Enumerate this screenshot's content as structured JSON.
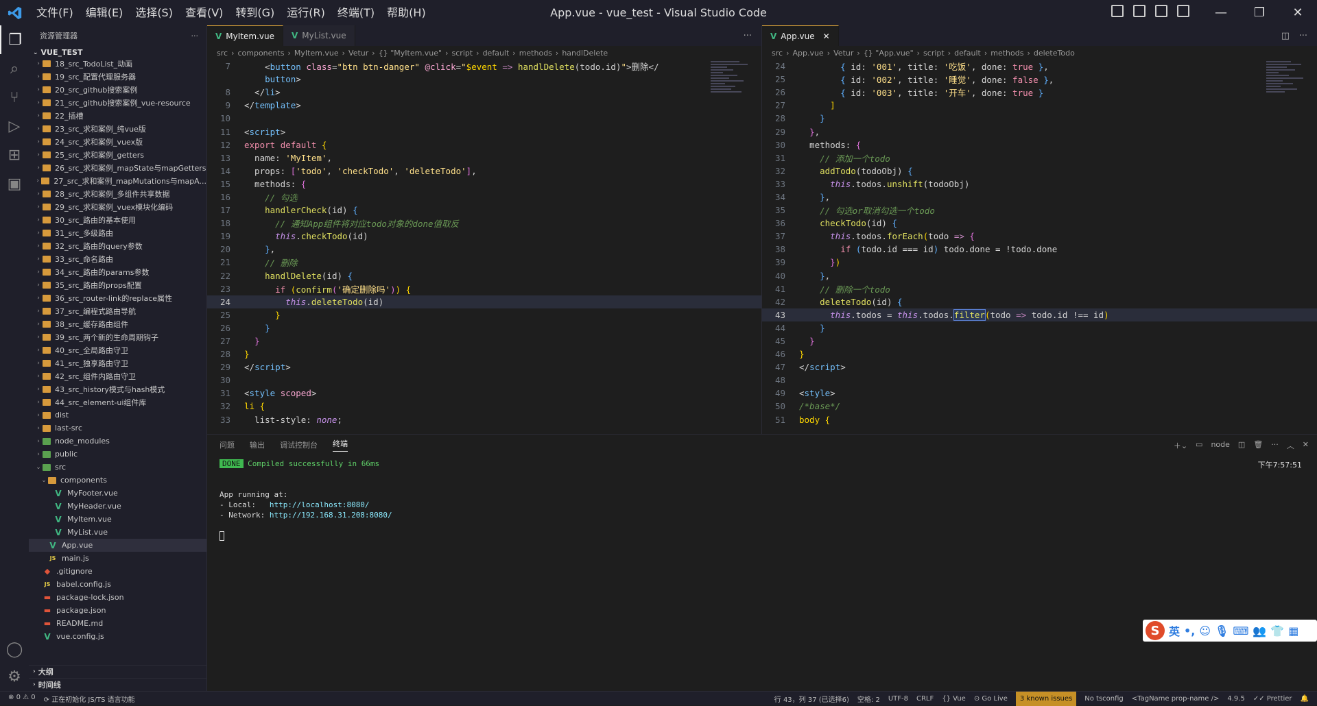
{
  "window": {
    "title": "App.vue - vue_test - Visual Studio Code"
  },
  "menu": [
    "文件(F)",
    "编辑(E)",
    "选择(S)",
    "查看(V)",
    "转到(G)",
    "运行(R)",
    "终端(T)",
    "帮助(H)"
  ],
  "sidebar": {
    "header": "资源管理器",
    "project": "VUE_TEST",
    "items": [
      {
        "label": "18_src_TodoList_动画",
        "icon": "folder",
        "indent": 1
      },
      {
        "label": "19_src_配置代理服务器",
        "icon": "folder",
        "indent": 1
      },
      {
        "label": "20_src_github搜索案例",
        "icon": "folder",
        "indent": 1
      },
      {
        "label": "21_src_github搜索案例_vue-resource",
        "icon": "folder",
        "indent": 1
      },
      {
        "label": "22_插槽",
        "icon": "folder",
        "indent": 1
      },
      {
        "label": "23_src_求和案例_纯vue版",
        "icon": "folder",
        "indent": 1
      },
      {
        "label": "24_src_求和案例_vuex版",
        "icon": "folder",
        "indent": 1
      },
      {
        "label": "25_src_求和案例_getters",
        "icon": "folder",
        "indent": 1
      },
      {
        "label": "26_src_求和案例_mapState与mapGetters",
        "icon": "folder",
        "indent": 1
      },
      {
        "label": "27_src_求和案例_mapMutations与mapA...",
        "icon": "folder",
        "indent": 1
      },
      {
        "label": "28_src_求和案例_多组件共享数据",
        "icon": "folder",
        "indent": 1
      },
      {
        "label": "29_src_求和案例_vuex模块化编码",
        "icon": "folder",
        "indent": 1
      },
      {
        "label": "30_src_路由的基本使用",
        "icon": "folder",
        "indent": 1
      },
      {
        "label": "31_src_多级路由",
        "icon": "folder",
        "indent": 1
      },
      {
        "label": "32_src_路由的query参数",
        "icon": "folder",
        "indent": 1
      },
      {
        "label": "33_src_命名路由",
        "icon": "folder",
        "indent": 1
      },
      {
        "label": "34_src_路由的params参数",
        "icon": "folder",
        "indent": 1
      },
      {
        "label": "35_src_路由的props配置",
        "icon": "folder",
        "indent": 1
      },
      {
        "label": "36_src_router-link的replace属性",
        "icon": "folder",
        "indent": 1
      },
      {
        "label": "37_src_编程式路由导航",
        "icon": "folder",
        "indent": 1
      },
      {
        "label": "38_src_缓存路由组件",
        "icon": "folder",
        "indent": 1
      },
      {
        "label": "39_src_两个新的生命周期钩子",
        "icon": "folder",
        "indent": 1
      },
      {
        "label": "40_src_全局路由守卫",
        "icon": "folder",
        "indent": 1
      },
      {
        "label": "41_src_独享路由守卫",
        "icon": "folder",
        "indent": 1
      },
      {
        "label": "42_src_组件内路由守卫",
        "icon": "folder",
        "indent": 1
      },
      {
        "label": "43_src_history模式与hash模式",
        "icon": "folder",
        "indent": 1
      },
      {
        "label": "44_src_element-ui组件库",
        "icon": "folder",
        "indent": 1
      },
      {
        "label": "dist",
        "icon": "folder",
        "indent": 1
      },
      {
        "label": "last-src",
        "icon": "folder",
        "indent": 1
      },
      {
        "label": "node_modules",
        "icon": "folder-green",
        "indent": 1
      },
      {
        "label": "public",
        "icon": "folder-green",
        "indent": 1
      },
      {
        "label": "src",
        "icon": "folder-green",
        "indent": 1,
        "open": true
      },
      {
        "label": "components",
        "icon": "folder",
        "indent": 2,
        "open": true
      },
      {
        "label": "MyFooter.vue",
        "icon": "vue",
        "indent": 3
      },
      {
        "label": "MyHeader.vue",
        "icon": "vue",
        "indent": 3
      },
      {
        "label": "MyItem.vue",
        "icon": "vue",
        "indent": 3
      },
      {
        "label": "MyList.vue",
        "icon": "vue",
        "indent": 3
      },
      {
        "label": "App.vue",
        "icon": "vue",
        "indent": 2,
        "selected": true
      },
      {
        "label": "main.js",
        "icon": "js",
        "indent": 2
      },
      {
        "label": ".gitignore",
        "icon": "git",
        "indent": 1
      },
      {
        "label": "babel.config.js",
        "icon": "js",
        "indent": 1
      },
      {
        "label": "package-lock.json",
        "icon": "json",
        "indent": 1
      },
      {
        "label": "package.json",
        "icon": "json",
        "indent": 1
      },
      {
        "label": "README.md",
        "icon": "md",
        "indent": 1
      },
      {
        "label": "vue.config.js",
        "icon": "vue",
        "indent": 1
      }
    ],
    "sections": [
      "大纲",
      "时间线"
    ]
  },
  "left_editor": {
    "tabs": [
      {
        "label": "MyItem.vue",
        "active": true
      },
      {
        "label": "MyList.vue",
        "active": false
      }
    ],
    "breadcrumb": [
      "src",
      "components",
      "MyItem.vue",
      "Vetur",
      "{} \"MyItem.vue\"",
      "script",
      "default",
      "methods",
      "handlDelete"
    ],
    "lines": [
      {
        "n": "7",
        "html": "    <span class='p'>&lt;</span><span class='t'>button</span> <span class='a'>class</span>=<span class='s'>\"btn btn-danger\"</span> <span class='a'>@click</span>=<span class='s'>\"</span><span class='y'>$event</span> <span class='k'>=&gt;</span> <span class='f'>handlDelete</span>(todo.id)<span class='s'>\"</span>&gt;删除&lt;/"
      },
      {
        "n": "",
        "html": "    <span class='t'>button</span>&gt;"
      },
      {
        "n": "8",
        "html": "  &lt;/<span class='t'>li</span>&gt;"
      },
      {
        "n": "9",
        "html": "&lt;/<span class='t'>template</span>&gt;"
      },
      {
        "n": "10",
        "html": ""
      },
      {
        "n": "11",
        "html": "&lt;<span class='t'>script</span>&gt;"
      },
      {
        "n": "12",
        "html": "<span class='kw'>export</span> <span class='kw'>default</span> <span class='y'>{</span>"
      },
      {
        "n": "13",
        "html": "  name: <span class='s'>'MyItem'</span>,"
      },
      {
        "n": "14",
        "html": "  props: <span class='pk'>[</span><span class='s'>'todo'</span>, <span class='s'>'checkTodo'</span>, <span class='s'>'deleteTodo'</span><span class='pk'>]</span>,"
      },
      {
        "n": "15",
        "html": "  methods: <span class='pk'>{</span>"
      },
      {
        "n": "16",
        "html": "    <span class='c'>// 勾选</span>"
      },
      {
        "n": "17",
        "html": "    <span class='f'>handlerCheck</span>(id) <span class='b'>{</span>"
      },
      {
        "n": "18",
        "html": "      <span class='c'>// 通知App组件将对应todo对象的done值取反</span>"
      },
      {
        "n": "19",
        "html": "      <span class='th'>this</span>.<span class='f'>checkTodo</span>(id)"
      },
      {
        "n": "20",
        "html": "    <span class='b'>}</span>,"
      },
      {
        "n": "21",
        "html": "    <span class='c'>// 删除</span>"
      },
      {
        "n": "22",
        "html": "    <span class='f'>handlDelete</span>(id) <span class='b'>{</span>"
      },
      {
        "n": "23",
        "html": "      <span class='kw'>if</span> <span class='y'>(</span><span class='f'>confirm</span><span class='pk'>(</span><span class='s'>'确定删除吗'</span><span class='pk'>)</span><span class='y'>)</span> <span class='y'>{</span>"
      },
      {
        "n": "24",
        "html": "        <span class='th'>this</span>.<span class='f'>deleteTodo</span>(id)",
        "current": true
      },
      {
        "n": "25",
        "html": "      <span class='y'>}</span>"
      },
      {
        "n": "26",
        "html": "    <span class='b'>}</span>"
      },
      {
        "n": "27",
        "html": "  <span class='pk'>}</span>"
      },
      {
        "n": "28",
        "html": "<span class='y'>}</span>"
      },
      {
        "n": "29",
        "html": "&lt;/<span class='t'>script</span>&gt;"
      },
      {
        "n": "30",
        "html": ""
      },
      {
        "n": "31",
        "html": "&lt;<span class='t'>style</span> <span class='a'>scoped</span>&gt;"
      },
      {
        "n": "32",
        "html": "<span class='y'>li</span> <span class='y'>{</span>"
      },
      {
        "n": "33",
        "html": "  list-style: <span class='th'>none</span>;"
      }
    ]
  },
  "right_editor": {
    "tabs": [
      {
        "label": "App.vue",
        "active": true
      }
    ],
    "breadcrumb": [
      "src",
      "App.vue",
      "Vetur",
      "{} \"App.vue\"",
      "script",
      "default",
      "methods",
      "deleteTodo"
    ],
    "lines": [
      {
        "n": "24",
        "html": "        <span class='b'>{</span> id: <span class='s'>'001'</span>, title: <span class='s'>'吃饭'</span>, done: <span class='kw'>true</span> <span class='b'>}</span>,"
      },
      {
        "n": "25",
        "html": "        <span class='b'>{</span> id: <span class='s'>'002'</span>, title: <span class='s'>'睡觉'</span>, done: <span class='kw'>false</span> <span class='b'>}</span>,"
      },
      {
        "n": "26",
        "html": "        <span class='b'>{</span> id: <span class='s'>'003'</span>, title: <span class='s'>'开车'</span>, done: <span class='kw'>true</span> <span class='b'>}</span>"
      },
      {
        "n": "27",
        "html": "      <span class='y'>]</span>"
      },
      {
        "n": "28",
        "html": "    <span class='b'>}</span>"
      },
      {
        "n": "29",
        "html": "  <span class='pk'>}</span>,"
      },
      {
        "n": "30",
        "html": "  methods: <span class='pk'>{</span>"
      },
      {
        "n": "31",
        "html": "    <span class='c'>// 添加一个todo</span>"
      },
      {
        "n": "32",
        "html": "    <span class='f'>addTodo</span>(todoObj) <span class='b'>{</span>"
      },
      {
        "n": "33",
        "html": "      <span class='th'>this</span>.todos.<span class='f'>unshift</span>(todoObj)"
      },
      {
        "n": "34",
        "html": "    <span class='b'>}</span>,"
      },
      {
        "n": "35",
        "html": "    <span class='c'>// 勾选or取消勾选一个todo</span>"
      },
      {
        "n": "36",
        "html": "    <span class='f'>checkTodo</span>(id) <span class='b'>{</span>"
      },
      {
        "n": "37",
        "html": "      <span class='th'>this</span>.todos.<span class='f'>forEach</span><span class='y'>(</span>todo <span class='k'>=&gt;</span> <span class='pk'>{</span>"
      },
      {
        "n": "38",
        "html": "        <span class='kw'>if</span> <span class='b'>(</span>todo.id === id<span class='b'>)</span> todo.done = !todo.done"
      },
      {
        "n": "39",
        "html": "      <span class='pk'>}</span><span class='y'>)</span>"
      },
      {
        "n": "40",
        "html": "    <span class='b'>}</span>,"
      },
      {
        "n": "41",
        "html": "    <span class='c'>// 删除一个todo</span>"
      },
      {
        "n": "42",
        "html": "    <span class='f'>deleteTodo</span>(id) <span class='b'>{</span>"
      },
      {
        "n": "43",
        "html": "      <span class='th'>this</span>.todos = <span class='th'>this</span>.todos.<span class='f' style='outline:1px solid #5a7fd0;background:#2c3a5a'>filter</span><span class='y'>(</span>todo <span class='k'>=&gt;</span> todo.id !== id<span class='y'>)</span>",
        "current": true
      },
      {
        "n": "44",
        "html": "    <span class='b'>}</span>"
      },
      {
        "n": "45",
        "html": "  <span class='pk'>}</span>"
      },
      {
        "n": "46",
        "html": "<span class='y'>}</span>"
      },
      {
        "n": "47",
        "html": "&lt;/<span class='t'>script</span>&gt;"
      },
      {
        "n": "48",
        "html": ""
      },
      {
        "n": "49",
        "html": "&lt;<span class='t'>style</span>&gt;"
      },
      {
        "n": "50",
        "html": "<span class='c'>/*base*/</span>"
      },
      {
        "n": "51",
        "html": "<span class='y'>body</span> <span class='y'>{</span>"
      }
    ]
  },
  "panel": {
    "tabs": [
      "问题",
      "输出",
      "调试控制台",
      "终端"
    ],
    "active_tab": "终端",
    "terminal_name": "node",
    "timestamp": "下午7:57:51",
    "done_badge": "DONE",
    "compiled_msg": "Compiled successfully in 66ms",
    "running": "App running at:",
    "local_label": "- Local:   ",
    "local_url": "http://localhost:8080/",
    "network_label": "- Network: ",
    "network_url": "http://192.168.31.208:8080/"
  },
  "status": {
    "errors": "0",
    "warnings": "0",
    "init_msg": "正在初始化 JS/TS 语言功能",
    "position": "行 43，列 37 (已选择6)",
    "spaces": "空格: 2",
    "encoding": "UTF-8",
    "eol": "CRLF",
    "language": "Vue",
    "golive": "Go Live",
    "issues": "3 known issues",
    "tsconfig": "No tsconfig",
    "tagname": "<TagName prop-name />",
    "version": "4.9.5",
    "prettier": "Prettier"
  },
  "ime": {
    "lang": "英"
  }
}
